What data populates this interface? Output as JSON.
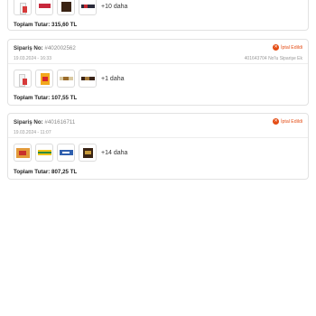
{
  "orders": [
    {
      "more_label": "+10 daha",
      "total_label": "Toplam Tutar: 315,60 TL"
    },
    {
      "order_no_label": "Sipariş No:",
      "order_no": "#402002562",
      "date": "19.03.2024 - 16:33",
      "status": "İptal Edildi",
      "reference": "401643704 No'lu Siparişe Ek",
      "more_label": "+1 daha",
      "total_label": "Toplam Tutar: 107,55 TL"
    },
    {
      "order_no_label": "Sipariş No:",
      "order_no": "#401616711",
      "date": "19.03.2024 - 11:07",
      "status": "İptal Edildi",
      "more_label": "+14 daha",
      "total_label": "Toplam Tutar: 807,25 TL"
    }
  ],
  "colors": {
    "status": "#e44c14",
    "border": "#e2e2e2"
  }
}
